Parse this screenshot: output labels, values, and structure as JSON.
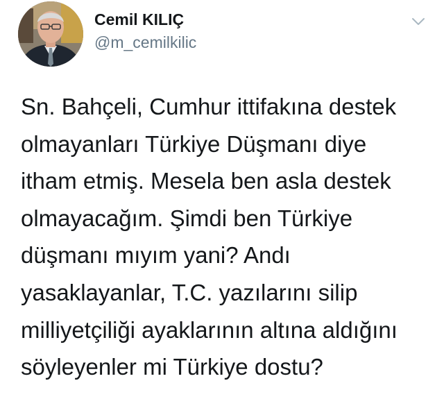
{
  "author": {
    "display_name": "Cemil KILIÇ",
    "handle": "@m_cemilkilic",
    "avatar_icon": "profile-photo"
  },
  "menu": {
    "icon": "chevron-down-icon"
  },
  "tweet": {
    "lines": [
      "Sn. Bahçeli, Cumhur ittifakına destek",
      "olmayanları Türkiye Düşmanı diye",
      "itham etmiş. Mesela ben asla destek",
      "olmayacağım. Şimdi ben Türkiye",
      "düşmanı mıyım yani? Andı",
      "yasaklayanlar, T.C. yazılarını silip",
      "milliyetçiliği ayaklarının altına aldığını",
      "söyleyenler mi Türkiye dostu?"
    ]
  },
  "colors": {
    "text": "#14171a",
    "secondary": "#657786",
    "caret": "#aab8c2"
  }
}
